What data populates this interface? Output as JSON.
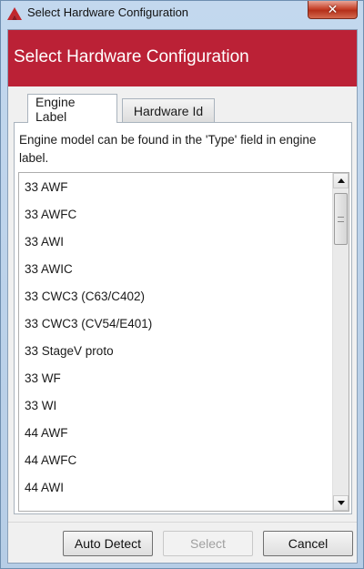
{
  "window": {
    "title": "Select Hardware Configuration",
    "close_glyph": "✕"
  },
  "header": {
    "title": "Select Hardware Configuration",
    "color": "#bb2136"
  },
  "tabs": [
    {
      "label": "Engine Label",
      "active": true
    },
    {
      "label": "Hardware Id",
      "active": false
    }
  ],
  "panel": {
    "info_text": "Engine model can be found in the 'Type' field in engine label."
  },
  "list": {
    "items": [
      "33 AWF",
      "33 AWFC",
      "33 AWI",
      "33 AWIC",
      "33 CWC3 (C63/C402)",
      "33 CWC3 (CV54/E401)",
      "33 StageV proto",
      "33 WF",
      "33 WI",
      "44 AWF",
      "44 AWFC",
      "44 AWI"
    ]
  },
  "scrollbar": {
    "up_icon": "triangle-up-icon",
    "down_icon": "triangle-down-icon",
    "position": 0.0
  },
  "footer": {
    "auto_detect_label": "Auto Detect",
    "select_label": "Select",
    "select_enabled": false,
    "cancel_label": "Cancel"
  }
}
